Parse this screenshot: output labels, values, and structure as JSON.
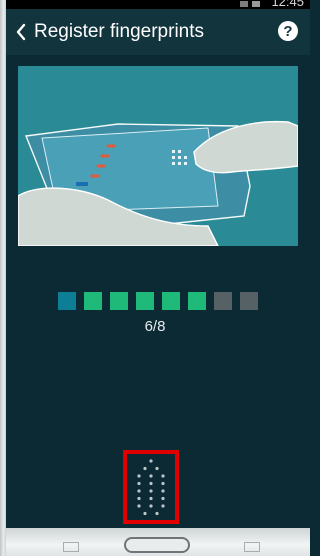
{
  "status_bar": {
    "time": "12:45"
  },
  "header": {
    "back_icon": "chevron-left-icon",
    "title": "Register fingerprints",
    "help_icon": "help-circle-icon",
    "help_glyph": "?"
  },
  "illustration": {
    "description_icon": "finger-swipe-on-home-key-illustration"
  },
  "progress": {
    "text": "6/8",
    "completed": 6,
    "total": 8,
    "colors": {
      "current": "#0e7d96",
      "done": "#1fba7a",
      "pending": "#566165"
    }
  },
  "colors": {
    "background": "#0c2a33",
    "action_bar": "#12343d",
    "highlight_border": "#e00000"
  }
}
